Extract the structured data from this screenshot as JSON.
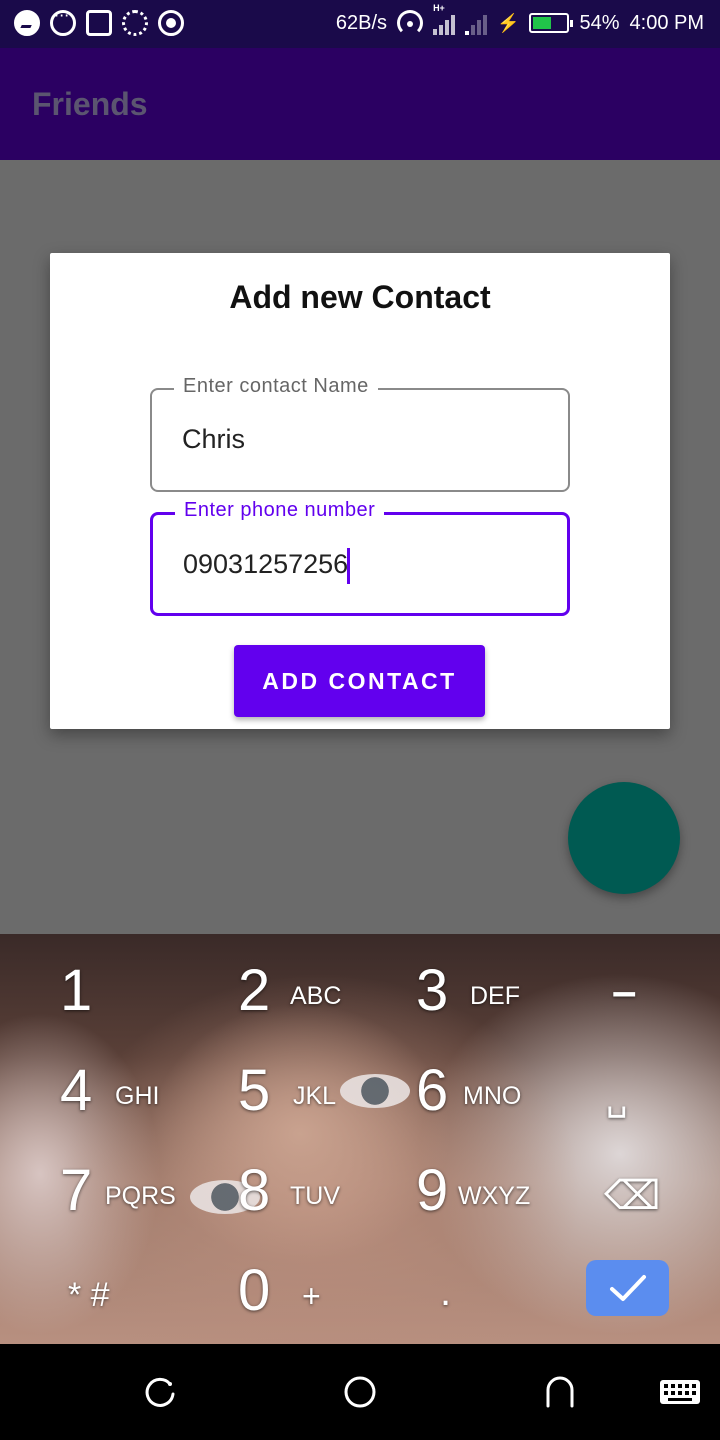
{
  "status_bar": {
    "net_speed": "62B/s",
    "network_type": "H+",
    "battery_percent": "54%",
    "battery_level": 0.54,
    "time": "4:00 PM",
    "icons": [
      "messenger-icon",
      "chat-icon",
      "cast-icon",
      "wheel-icon",
      "target-icon",
      "hotspot-icon",
      "signal-icon",
      "charging-icon",
      "battery-icon"
    ]
  },
  "app_bar": {
    "title": "Friends"
  },
  "dialog": {
    "title": "Add new Contact",
    "name_field": {
      "label": "Enter contact Name",
      "value": "Chris"
    },
    "phone_field": {
      "label": "Enter phone number",
      "value": "09031257256"
    },
    "add_button": "ADD CONTACT"
  },
  "keyboard": {
    "rows": [
      [
        {
          "digit": "1",
          "letters": ""
        },
        {
          "digit": "2",
          "letters": "ABC"
        },
        {
          "digit": "3",
          "letters": "DEF"
        },
        {
          "symbol": "–"
        }
      ],
      [
        {
          "digit": "4",
          "letters": "GHI"
        },
        {
          "digit": "5",
          "letters": "JKL"
        },
        {
          "digit": "6",
          "letters": "MNO"
        },
        {
          "symbol": "␣"
        }
      ],
      [
        {
          "digit": "7",
          "letters": "PQRS"
        },
        {
          "digit": "8",
          "letters": "TUV"
        },
        {
          "digit": "9",
          "letters": "WXYZ"
        },
        {
          "symbol": "⌫"
        }
      ],
      [
        {
          "symbol": "* #"
        },
        {
          "digit": "0",
          "letters": "+"
        },
        {
          "symbol": "."
        },
        {
          "symbol": "✓"
        }
      ]
    ]
  },
  "nav_bar": {
    "icons": [
      "recent-apps-icon",
      "home-icon",
      "back-icon",
      "keyboard-switch-icon"
    ]
  },
  "colors": {
    "primary": "#6200ee",
    "app_bar": "#2b0062",
    "fab": "#005a52",
    "done_key": "#5b8def"
  }
}
